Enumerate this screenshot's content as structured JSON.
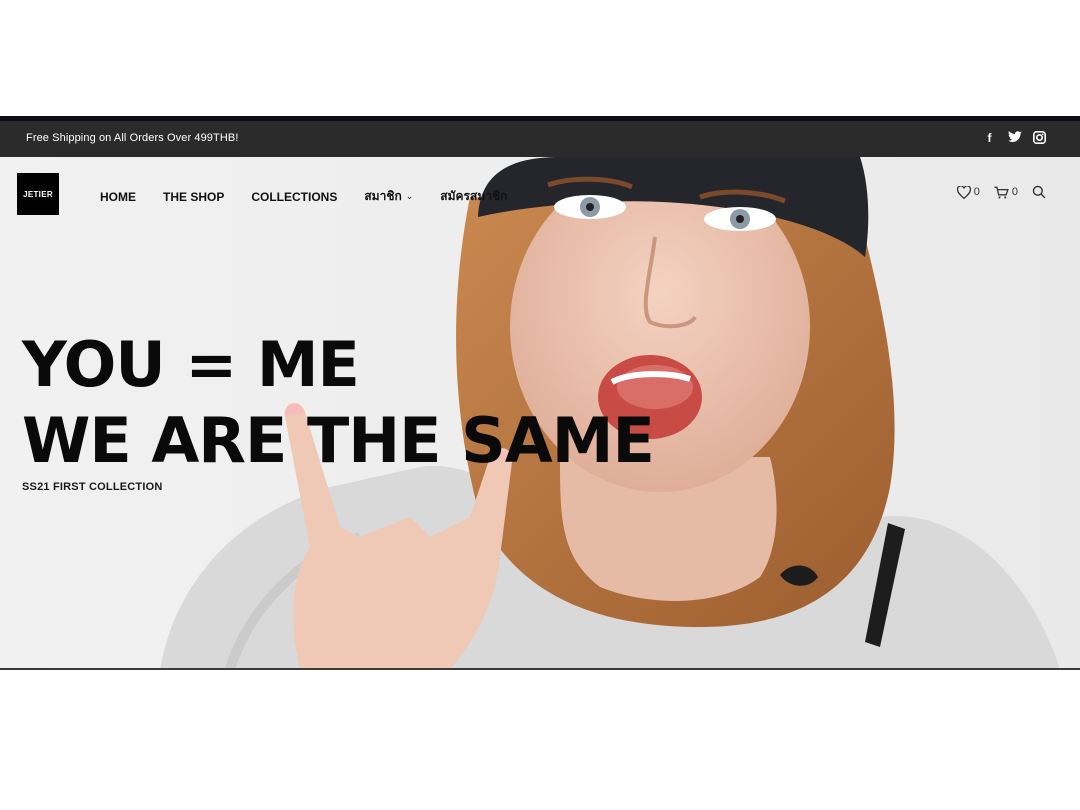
{
  "announcement": {
    "text": "Free Shipping on All Orders Over 499THB!"
  },
  "social": [
    {
      "icon": "facebook-icon",
      "glyph": "f"
    },
    {
      "icon": "twitter-icon"
    },
    {
      "icon": "instagram-icon"
    }
  ],
  "logo": {
    "text": "JETIER"
  },
  "nav": {
    "items": [
      {
        "label": "HOME"
      },
      {
        "label": "THE SHOP"
      },
      {
        "label": "COLLECTIONS"
      },
      {
        "label": "สมาชิก",
        "dropdown": true
      },
      {
        "label": "สมัครสมาชิก"
      }
    ]
  },
  "header_icons": {
    "wishlist_count": "0",
    "cart_count": "0"
  },
  "hero": {
    "line1": "YOU = ME",
    "line2": "WE ARE THE SAME",
    "subtitle": "SS21 FIRST COLLECTION"
  },
  "colors": {
    "announcement_bg": "#2b2b2b",
    "text": "#111111",
    "logo_bg": "#000000"
  }
}
